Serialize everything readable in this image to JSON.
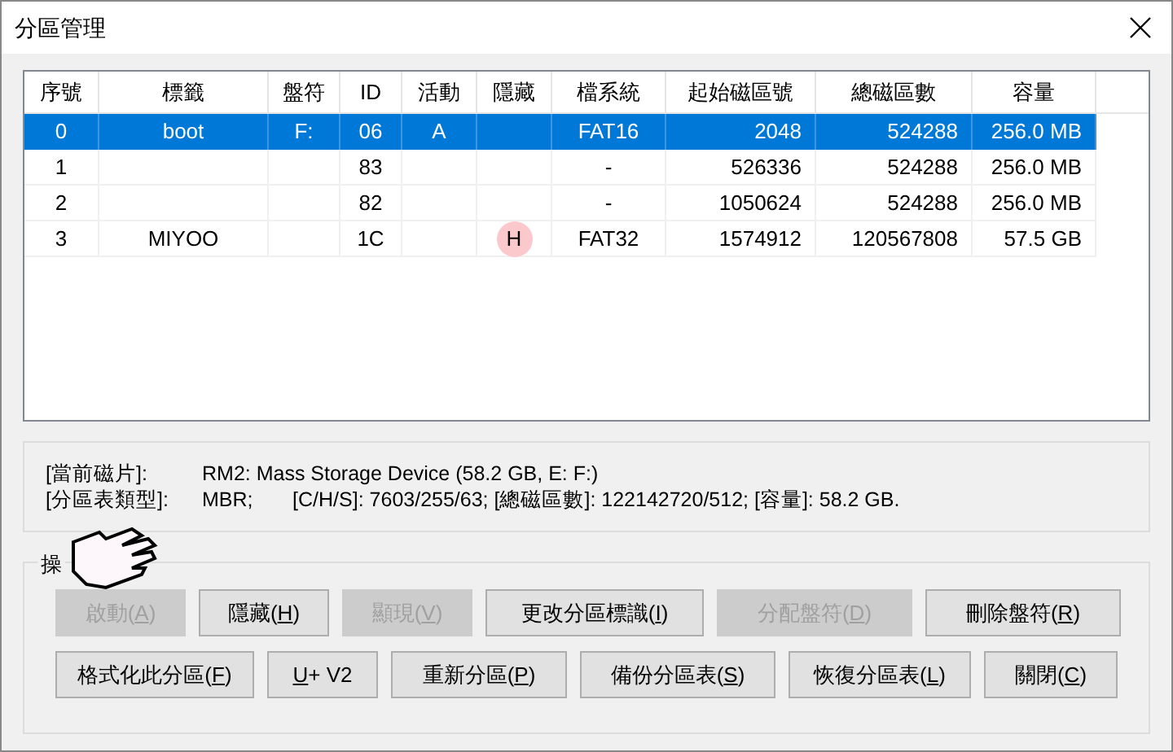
{
  "window": {
    "title": "分區管理"
  },
  "table": {
    "columns": [
      "序號",
      "標籤",
      "盤符",
      "ID",
      "活動",
      "隱藏",
      "檔系統",
      "起始磁區號",
      "總磁區數",
      "容量"
    ],
    "rows": [
      {
        "cells": [
          "0",
          "boot",
          "F:",
          "06",
          "A",
          "",
          "FAT16",
          "2048",
          "524288",
          "256.0 MB"
        ],
        "selected": true,
        "circled": false
      },
      {
        "cells": [
          "1",
          "",
          "",
          "83",
          "",
          "",
          "-",
          "526336",
          "524288",
          "256.0 MB"
        ],
        "selected": false,
        "circled": false
      },
      {
        "cells": [
          "2",
          "",
          "",
          "82",
          "",
          "",
          "-",
          "1050624",
          "524288",
          "256.0 MB"
        ],
        "selected": false,
        "circled": false
      },
      {
        "cells": [
          "3",
          "MIYOO",
          "",
          "1C",
          "",
          "H",
          "FAT32",
          "1574912",
          "120567808",
          "57.5 GB"
        ],
        "selected": false,
        "circled": true
      }
    ]
  },
  "info": [
    {
      "label": "[當前磁片]:",
      "value": "RM2: Mass Storage Device (58.2 GB, E: F:)"
    },
    {
      "label": "[分區表類型]:",
      "value": "MBR;       [C/H/S]: 7603/255/63; [總磁區數]: 122142720/512; [容量]: 58.2 GB."
    }
  ],
  "operations": {
    "title": "操",
    "rows": [
      [
        {
          "before": "啟動(",
          "key": "A",
          "after": ")",
          "disabled": true
        },
        {
          "before": "隱藏(",
          "key": "H",
          "after": ")",
          "disabled": false
        },
        {
          "before": "顯現(",
          "key": "V",
          "after": ")",
          "disabled": true
        },
        {
          "before": "更改分區標識(",
          "key": "I",
          "after": ")",
          "disabled": false
        },
        {
          "before": "分配盤符(",
          "key": "D",
          "after": ")",
          "disabled": true
        },
        {
          "before": "刪除盤符(",
          "key": "R",
          "after": ")",
          "disabled": false
        }
      ],
      [
        {
          "before": "格式化此分區(",
          "key": "F",
          "after": ")",
          "disabled": false
        },
        {
          "key": "U",
          "after": "+ V2",
          "disabled": false
        },
        {
          "before": "重新分區(",
          "key": "P",
          "after": ")",
          "disabled": false
        },
        {
          "before": "備份分區表(",
          "key": "S",
          "after": ")",
          "disabled": false
        },
        {
          "before": "恢復分區表(",
          "key": "L",
          "after": ")",
          "disabled": false
        },
        {
          "before": "關閉(",
          "key": "C",
          "after": ")",
          "disabled": false
        }
      ]
    ]
  }
}
